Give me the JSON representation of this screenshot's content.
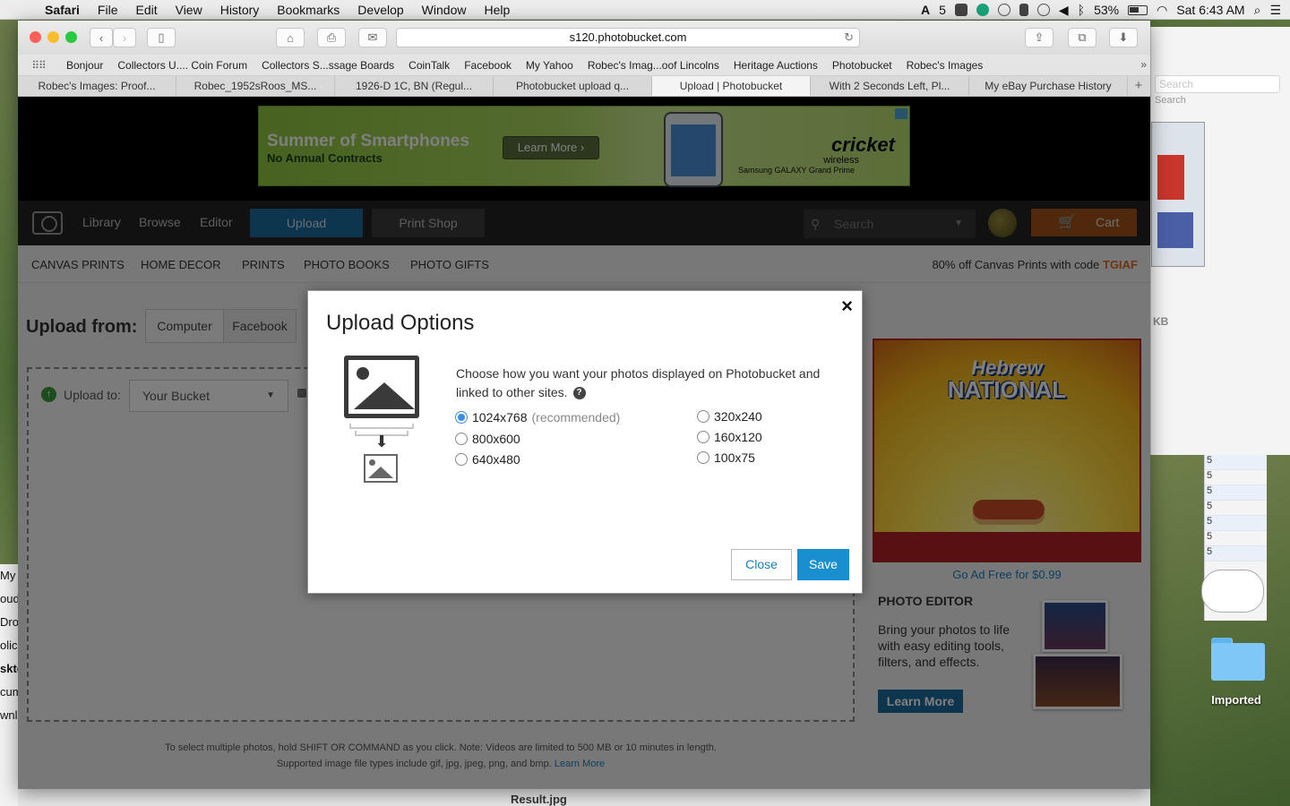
{
  "menubar": {
    "app_name": "Safari",
    "items": [
      "File",
      "Edit",
      "View",
      "History",
      "Bookmarks",
      "Develop",
      "Window",
      "Help"
    ],
    "adobe_count": "5",
    "battery": "53%",
    "clock": "Sat 6:43 AM"
  },
  "browser": {
    "url": "s120.photobucket.com",
    "bookmarks": [
      "Bonjour",
      "Collectors U.... Coin Forum",
      "Collectors S...ssage Boards",
      "CoinTalk",
      "Facebook",
      "My Yahoo",
      "Robec's Imag...oof Lincolns",
      "Heritage Auctions",
      "Photobucket",
      "Robec's Images"
    ],
    "tabs": [
      {
        "label": "Robec's Images: Proof..."
      },
      {
        "label": "Robec_1952sRoos_MS..."
      },
      {
        "label": "1926-D 1C, BN (Regul..."
      },
      {
        "label": "Photobucket upload q..."
      },
      {
        "label": "Upload | Photobucket"
      },
      {
        "label": "With 2 Seconds Left, Pl..."
      },
      {
        "label": "My eBay Purchase History"
      }
    ]
  },
  "top_ad": {
    "headline": "Summer of Smartphones",
    "subline": "No Annual Contracts",
    "button": "Learn More",
    "brand": "cricket",
    "brand_sub": "wireless",
    "device": "Samsung GALAXY Grand Prime"
  },
  "site_nav": {
    "library": "Library",
    "browse": "Browse",
    "editor": "Editor",
    "upload": "Upload",
    "print_shop": "Print Shop",
    "search_placeholder": "Search",
    "cart": "Cart"
  },
  "sub_nav": {
    "items": [
      "CANVAS PRINTS",
      "HOME DECOR",
      "PRINTS",
      "PHOTO BOOKS",
      "PHOTO GIFTS"
    ],
    "promo_text": "80% off Canvas Prints with code",
    "promo_code": "TGIAF"
  },
  "upload_page": {
    "upload_from": "Upload from:",
    "sources": [
      "Computer",
      "Facebook"
    ],
    "upload_to_label": "Upload to:",
    "bucket": "Your Bucket",
    "footnote_line1": "To select multiple photos, hold SHIFT OR COMMAND as you click. Note: Videos are limited to 500 MB or 10 minutes in length.",
    "footnote_line2": "Supported image file types include gif, jpg, jpeg, png, and bmp.",
    "footnote_link": "Learn More"
  },
  "side_ad": {
    "brand_top": "Hebrew",
    "brand_bottom": "NATIONAL",
    "ad_free": "Go Ad Free for $0.99",
    "photo_editor_title": "PHOTO EDITOR",
    "photo_editor_text": "Bring your photos to life with easy editing tools, filters, and effects.",
    "learn_more": "Learn More"
  },
  "modal": {
    "title": "Upload Options",
    "prompt": "Choose how you want your photos displayed on Photobucket and linked to other sites.",
    "recommended": "(recommended)",
    "options_left": [
      {
        "label": "1024x768",
        "selected": true
      },
      {
        "label": "800x600",
        "selected": false
      },
      {
        "label": "640x480",
        "selected": false
      }
    ],
    "options_right": [
      {
        "label": "320x240",
        "selected": false
      },
      {
        "label": "160x120",
        "selected": false
      },
      {
        "label": "100x75",
        "selected": false
      }
    ],
    "close_button": "Close",
    "save_button": "Save"
  },
  "desktop": {
    "folder_label": "Imported",
    "search_placeholder": "Search",
    "size_label": "KB",
    "bottom_file": "Result.jpg",
    "left_strip": [
      "My",
      "oud",
      "Dro",
      "olica",
      "skto",
      "cum",
      "wnl"
    ]
  }
}
